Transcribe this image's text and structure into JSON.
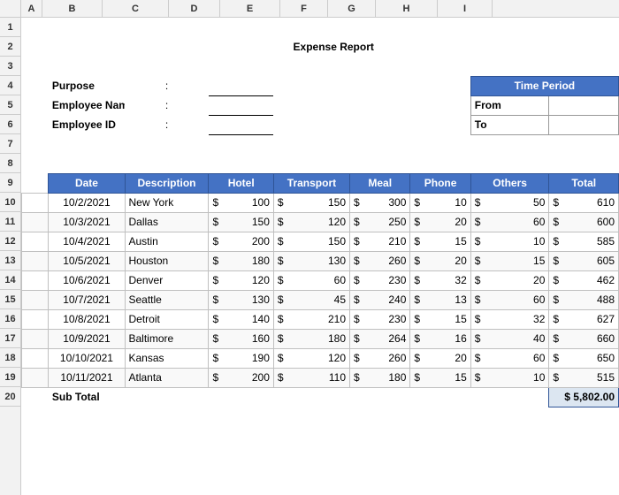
{
  "title": "Expense Report",
  "header": {
    "purpose_label": "Purpose",
    "employee_name_label": "Employee Name",
    "employee_id_label": "Employee ID",
    "colon": ":",
    "time_period_label": "Time Period",
    "from_label": "From",
    "to_label": "To"
  },
  "columns": [
    "A",
    "B",
    "C",
    "D",
    "E",
    "F",
    "G",
    "H",
    "I"
  ],
  "row_numbers": [
    "1",
    "2",
    "3",
    "4",
    "5",
    "6",
    "7",
    "8",
    "9",
    "10",
    "11",
    "12",
    "13",
    "14",
    "15",
    "16",
    "17",
    "18",
    "19",
    "20"
  ],
  "table_headers": {
    "date": "Date",
    "description": "Description",
    "hotel": "Hotel",
    "transport": "Transport",
    "meal": "Meal",
    "phone": "Phone",
    "others": "Others",
    "total": "Total"
  },
  "rows": [
    {
      "date": "10/2/2021",
      "desc": "New York",
      "hotel": 100,
      "transport": 150,
      "meal": 300,
      "phone": 10,
      "others": 50,
      "total": 610
    },
    {
      "date": "10/3/2021",
      "desc": "Dallas",
      "hotel": 150,
      "transport": 120,
      "meal": 250,
      "phone": 20,
      "others": 60,
      "total": 600
    },
    {
      "date": "10/4/2021",
      "desc": "Austin",
      "hotel": 200,
      "transport": 150,
      "meal": 210,
      "phone": 15,
      "others": 10,
      "total": 585
    },
    {
      "date": "10/5/2021",
      "desc": "Houston",
      "hotel": 180,
      "transport": 130,
      "meal": 260,
      "phone": 20,
      "others": 15,
      "total": 605
    },
    {
      "date": "10/6/2021",
      "desc": "Denver",
      "hotel": 120,
      "transport": 60,
      "meal": 230,
      "phone": 32,
      "others": 20,
      "total": 462
    },
    {
      "date": "10/7/2021",
      "desc": "Seattle",
      "hotel": 130,
      "transport": 45,
      "meal": 240,
      "phone": 13,
      "others": 60,
      "total": 488
    },
    {
      "date": "10/8/2021",
      "desc": "Detroit",
      "hotel": 140,
      "transport": 210,
      "meal": 230,
      "phone": 15,
      "others": 32,
      "total": 627
    },
    {
      "date": "10/9/2021",
      "desc": "Baltimore",
      "hotel": 160,
      "transport": 180,
      "meal": 264,
      "phone": 16,
      "others": 40,
      "total": 660
    },
    {
      "date": "10/10/2021",
      "desc": "Kansas",
      "hotel": 190,
      "transport": 120,
      "meal": 260,
      "phone": 20,
      "others": 60,
      "total": 650
    },
    {
      "date": "10/11/2021",
      "desc": "Atlanta",
      "hotel": 200,
      "transport": 110,
      "meal": 180,
      "phone": 15,
      "others": 10,
      "total": 515
    }
  ],
  "subtotal_label": "Sub Total",
  "subtotal_value": "$ 5,802.00",
  "dollar_sign": "$"
}
